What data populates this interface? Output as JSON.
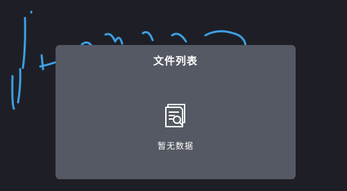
{
  "background_canvas": {
    "stroke_color": "#3ea0e6",
    "background_color": "#1e1f26"
  },
  "file_list_modal": {
    "title": "文件列表",
    "empty_icon": "document-search-icon",
    "empty_text": "暂无数据",
    "background_color": "#555963"
  }
}
